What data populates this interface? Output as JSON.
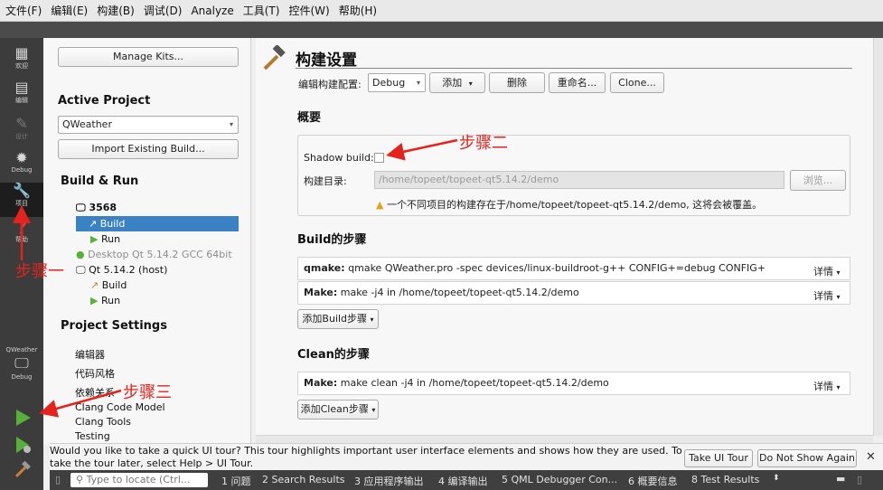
{
  "menu": [
    "文件(F)",
    "编辑(E)",
    "构建(B)",
    "调试(D)",
    "Analyze",
    "工具(T)",
    "控件(W)",
    "帮助(H)"
  ],
  "modes": {
    "welcome": "欢迎",
    "edit": "编辑",
    "design": "设计",
    "debug": "Debug",
    "projects": "项目",
    "help": "帮助"
  },
  "kit_selector": {
    "project": "QWeather",
    "mode": "Debug"
  },
  "project_panel": {
    "manage_kits": "Manage Kits...",
    "active_project_heading": "Active Project",
    "active_project": "QWeather",
    "import_build": "Import Existing Build...",
    "build_run_heading": "Build & Run",
    "kit_3568": "3568",
    "build": "Build",
    "run": "Run",
    "desktop_kit": "Desktop Qt 5.14.2 GCC 64bit",
    "host_kit": "Qt 5.14.2 (host)",
    "build2": "Build",
    "run2": "Run",
    "project_settings_heading": "Project Settings",
    "settings": [
      "编辑器",
      "代码风格",
      "依赖关系",
      "Clang Code Model",
      "Clang Tools",
      "Testing"
    ]
  },
  "build_settings": {
    "title": "构建设置",
    "config_label": "编辑构建配置:",
    "config_value": "Debug",
    "add": "添加",
    "delete": "删除",
    "rename": "重命名...",
    "clone": "Clone...",
    "overview_heading": "概要",
    "shadow_build_label": "Shadow build:",
    "build_dir_label": "构建目录:",
    "build_dir_value": "/home/topeet/topeet-qt5.14.2/demo",
    "browse": "浏览...",
    "warning": "一个不同项目的构建存在于/home/topeet/topeet-qt5.14.2/demo, 这将会被覆盖。",
    "build_steps_heading": "Build的步骤",
    "qmake_step_bold": "qmake:",
    "qmake_step": "qmake QWeather.pro -spec devices/linux-buildroot-g++ CONFIG+=debug CONFIG+",
    "make_step_bold": "Make:",
    "make_step": "make -j4 in /home/topeet/topeet-qt5.14.2/demo",
    "details": "详情",
    "add_build_step": "添加Build步骤",
    "clean_steps_heading": "Clean的步骤",
    "clean_step_bold": "Make:",
    "clean_step": "make clean -j4 in /home/topeet/topeet-qt5.14.2/demo",
    "add_clean_step": "添加Clean步骤"
  },
  "tour": {
    "text": "Would you like to take a quick UI tour? This tour highlights important user interface elements and shows how they are used. To take the tour later, select Help > UI Tour.",
    "take": "Take UI Tour",
    "dismiss": "Do Not Show Again",
    "close": "✕"
  },
  "status": {
    "locate_placeholder": "Type to locate (Ctrl...",
    "panes": [
      "1 问题",
      "2 Search Results",
      "3 应用程序输出",
      "4 编译输出",
      "5 QML Debugger Con...",
      "6 概要信息",
      "8 Test Results"
    ]
  },
  "annotations": {
    "step1": "步骤一",
    "step2": "步骤二",
    "step3": "步骤三"
  },
  "colors": {
    "accent": "#3b82c5",
    "annotation": "#e5221c",
    "run_green": "#58b03a"
  }
}
